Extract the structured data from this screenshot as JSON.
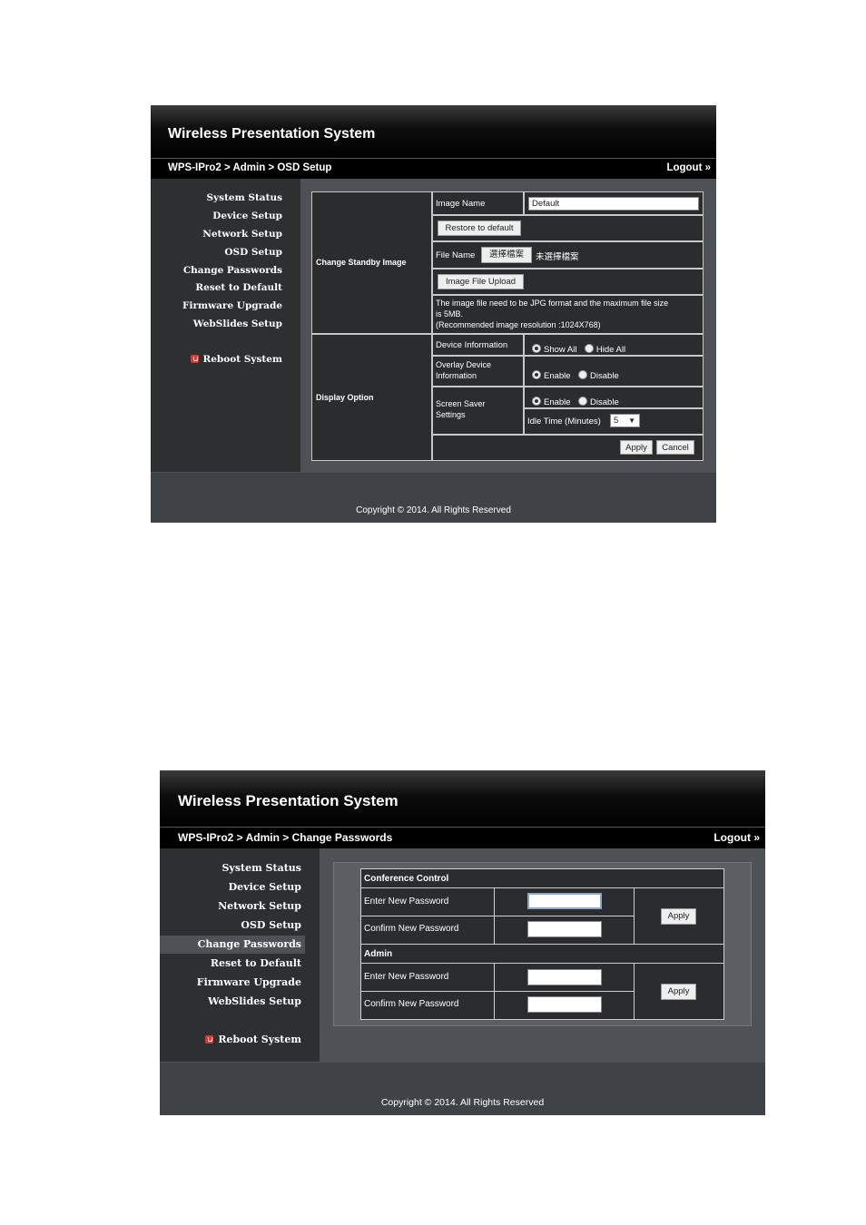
{
  "app_title": "Wireless Presentation System",
  "logout_label": "Logout »",
  "copyright": "Copyright © 2014. All Rights Reserved",
  "nav": {
    "items": [
      "System Status",
      "Device Setup",
      "Network Setup",
      "OSD Setup",
      "Change Passwords",
      "Reset to Default",
      "Firmware Upgrade",
      "WebSlides Setup"
    ],
    "reboot": "Reboot System"
  },
  "osd": {
    "breadcrumb": "WPS-IPro2 > Admin > OSD Setup",
    "change_standby_label": "Change Standby Image",
    "image_name_label": "Image Name",
    "image_name_value": "Default",
    "restore_button": "Restore to default",
    "file_name_label": "File Name",
    "choose_file_button": "選擇檔案",
    "no_file_text": "未選擇檔案",
    "upload_button": "Image File Upload",
    "note_line1": "The image file need to be JPG format and the maximum file size",
    "note_line2": "is 5MB.",
    "note_line3": "(Recommended image resolution :1024X768)",
    "display_option_label": "Display Option",
    "device_info_label": "Device Information",
    "show_all": "Show All",
    "hide_all": "Hide All",
    "overlay_label_1": "Overlay Device",
    "overlay_label_2": "Information",
    "enable": "Enable",
    "disable": "Disable",
    "screensaver_label_1": "Screen Saver",
    "screensaver_label_2": "Settings",
    "idle_time_label": "Idle Time (Minutes)",
    "idle_time_value": "5",
    "apply": "Apply",
    "cancel": "Cancel"
  },
  "pw": {
    "breadcrumb": "WPS-IPro2 > Admin > Change Passwords",
    "conference_header": "Conference Control",
    "admin_header": "Admin",
    "enter_new": "Enter New Password",
    "confirm_new": "Confirm New Password",
    "apply": "Apply"
  }
}
